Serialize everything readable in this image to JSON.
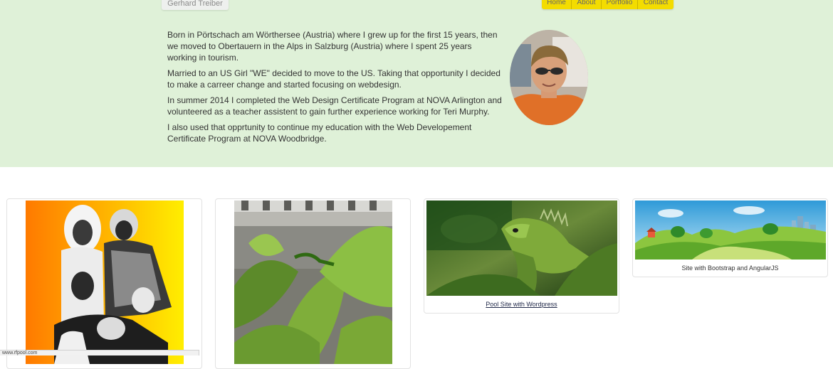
{
  "header": {
    "brand": "Gerhard Treiber",
    "nav": [
      {
        "label": "Home"
      },
      {
        "label": "About"
      },
      {
        "label": "Portfolio"
      },
      {
        "label": "Contact"
      }
    ],
    "nav_color": "#f3dc00"
  },
  "about": {
    "paragraphs": [
      "Born in Pörtschach am Wörthersee (Austria) where I grew up for the first 15 years, then we moved to Obertauern in the Alps in Salzburg (Austria) where I spent 25 years working in tourism.",
      "Married to an US Girl \"WE\" decided to move to the US. Taking that opportunity I decided to make a carreer change and started focusing on webdesign.",
      "In summer 2014 I completed the Web Design Certificate Program at NOVA Arlington and volunteered as a teacher assistent to gain further experience working for Teri Murphy.",
      "I also used that opprtunity to continue my education with the Web Developement Certificate Program at NOVA Woodbridge."
    ],
    "background": "#dff1d8",
    "photo_icon": "profile-photo"
  },
  "portfolio": {
    "cards": [
      {
        "image_icon": "family-photo-inverted",
        "caption": ""
      },
      {
        "image_icon": "green-lizard-on-leaves",
        "caption": ""
      },
      {
        "image_icon": "iguana-photo",
        "caption": "Pool Site with Wordpress"
      },
      {
        "image_icon": "cartoon-landscape",
        "caption": "Site with Bootstrap and AngularJS"
      }
    ]
  },
  "status_bar": {
    "url": "www.rfpool.com"
  }
}
